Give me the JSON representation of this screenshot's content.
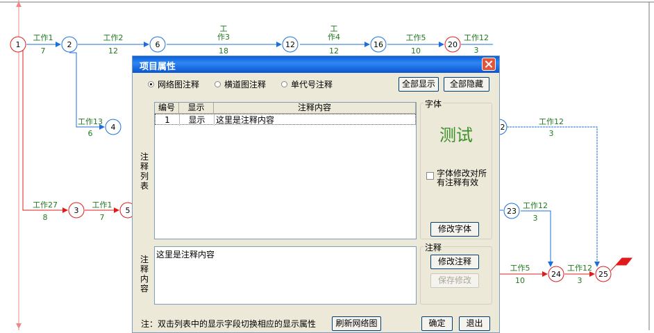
{
  "network": {
    "tasks": [
      {
        "name": "工作1",
        "duration": "7"
      },
      {
        "name": "工作2",
        "duration": "12"
      },
      {
        "name": "工\n作3",
        "duration": "18"
      },
      {
        "name": "工\n作4",
        "duration": "12"
      },
      {
        "name": "工作5",
        "duration": "10"
      },
      {
        "name": "工作12",
        "duration": "3"
      },
      {
        "name": "工作13",
        "duration": "6"
      },
      {
        "name": "工作27",
        "duration": "8"
      },
      {
        "name": "工作1",
        "duration": "7"
      },
      {
        "name": "工作12",
        "duration": "3"
      },
      {
        "name": "工作12",
        "duration": "3"
      },
      {
        "name": "工作5",
        "duration": "10"
      },
      {
        "name": "工作12",
        "duration": "3"
      }
    ],
    "nodes": [
      "1",
      "2",
      "6",
      "12",
      "16",
      "20",
      "4",
      "3",
      "5",
      "2",
      "23",
      "24",
      "25"
    ]
  },
  "dialog": {
    "title": "项目属性",
    "radios": [
      "网络图注释",
      "横道图注释",
      "单代号注释"
    ],
    "show_all": "全部显示",
    "hide_all": "全部隐藏",
    "list_label": "注\n释\n列\n表",
    "columns": [
      "编号",
      "显示",
      "注释内容"
    ],
    "rows": [
      {
        "id": "1",
        "show": "显示",
        "content": "这里是注释内容"
      }
    ],
    "content_label": "注\n释\n内\n容",
    "content_text": "这里是注释内容",
    "font_group": "字体",
    "font_sample": "测试",
    "font_check_label": "字体修改对所有注释有效",
    "change_font": "修改字体",
    "note_group": "注释",
    "modify_note": "修改注释",
    "save_change": "保存修改",
    "hint": "注：双击列表中的显示字段切换相应的显示属性",
    "refresh": "刷新网络图",
    "ok": "确定",
    "exit": "退出"
  }
}
